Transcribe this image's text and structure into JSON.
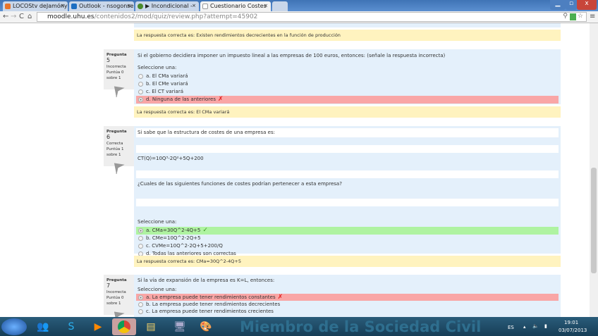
{
  "browser": {
    "tabs": [
      {
        "label": "LOCOStv deJamónyQ",
        "color": "#e8742a"
      },
      {
        "label": "Outlook - nsogonse",
        "color": "#1c6ec2"
      },
      {
        "label": "▶ Incondicional -",
        "color": "#4a8a2a"
      },
      {
        "label": "Cuestionario Costes",
        "color": "#ffffff",
        "active": true
      }
    ],
    "close_tab": "×",
    "url_host": "moodle.uhu.es",
    "url_path": "/contenidos2/mod/quiz/review.php?attempt=45902"
  },
  "prev_answer": "La respuesta correcta es: Existen rendimientos decrecientes en la función de producción",
  "questions": [
    {
      "label": "Pregunta",
      "num": "5",
      "status": "Incorrecta",
      "score": "Puntúa 0 sobre 1",
      "text": "Si el gobierno decidiera imponer un impuesto lineal a las empresas de 100 euros, entonces: (señale la respuesta incorrecta)",
      "select": "Seleccione una:",
      "options": [
        "a. El CMa variará",
        "b. El CMe variará",
        "c. El CT variará",
        "d. Ninguna de las anteriores"
      ],
      "answer": "La respuesta correcta es: El CMa variará"
    },
    {
      "label": "Pregunta",
      "num": "6",
      "status": "Correcta",
      "score": "Puntúa 1 sobre 1",
      "text": "Si sabe que la estructura de costes de una empresa es:",
      "formula": "CT(Q)=10Q³-2Q²+5Q+200",
      "text2": "¿Cuales de las siguientes funciones de costes podrían pertenecer a esta empresa?",
      "select": "Seleccione una:",
      "options": [
        "a. CMa=30Q^2-4Q+5",
        "b. CMe=10Q^2-2Q+5",
        "c. CVMe=10Q^2-2Q+5+200/Q",
        "d. Todas las anteriores son correctas"
      ],
      "answer": "La respuesta correcta es: CMa=30Q^2-4Q+5"
    },
    {
      "label": "Pregunta",
      "num": "7",
      "status": "Incorrecta",
      "score": "Puntúa 0 sobre 1",
      "text": "Si la vía de expansión de la empresa es K=L, entonces:",
      "select": "Seleccione una:",
      "options": [
        "a. La empresa puede tener rendimientos constantes",
        "b. La empresa puede tener rendimientos decrecientes",
        "c. La empresa puede tener rendimientos crecientes"
      ]
    }
  ],
  "marks": {
    "wrong": "✗",
    "right": "✓"
  },
  "taskbar": {
    "watermark": "Miembro de la Sociedad Civil",
    "lang": "ES",
    "time": "19:01",
    "date": "03/07/2013"
  }
}
